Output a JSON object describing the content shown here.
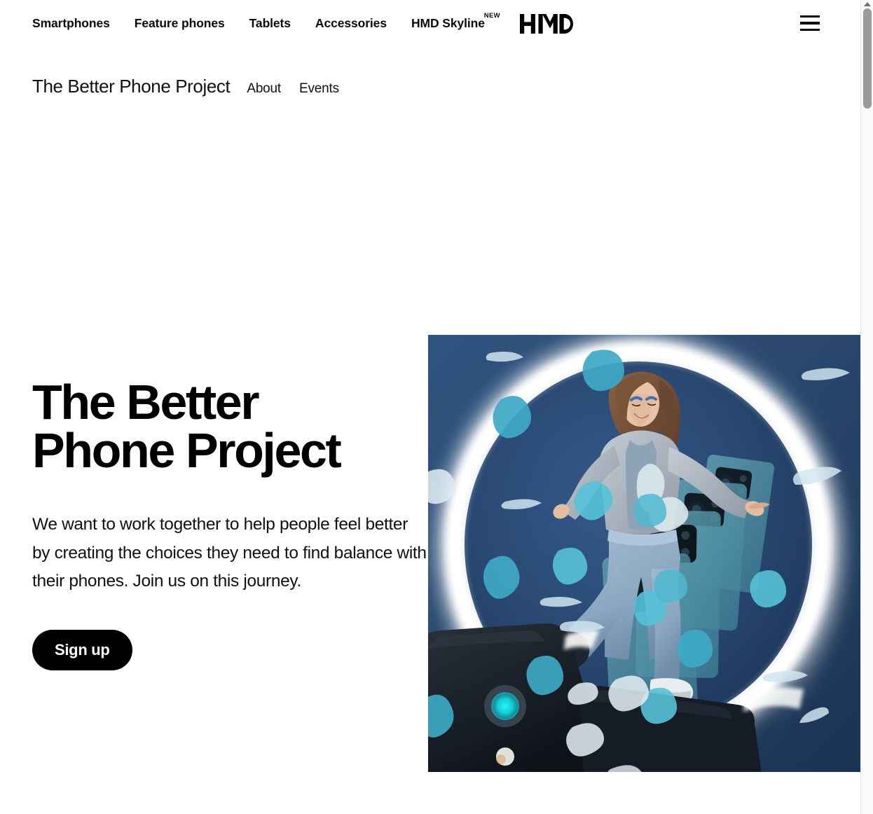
{
  "header": {
    "primary_nav": [
      {
        "label": "Smartphones",
        "badge": ""
      },
      {
        "label": "Feature phones",
        "badge": ""
      },
      {
        "label": "Tablets",
        "badge": ""
      },
      {
        "label": "Accessories",
        "badge": ""
      },
      {
        "label": "HMD Skyline",
        "badge": "NEW"
      }
    ],
    "logo_text": "HMD",
    "menu_icon": "hamburger-icon"
  },
  "subnav": {
    "project_title": "The Better Phone Project",
    "links": [
      {
        "label": "About"
      },
      {
        "label": "Events"
      }
    ]
  },
  "hero": {
    "title": "The Better\nPhone Project",
    "subtitle": "We want to work together to help people feel better by creating the choices they need to find balance with their phones. Join us on this journey.",
    "cta_label": "Sign up",
    "image_alt": "Young woman standing on oversized dark phone camera modules inside a glowing white ring, surrounded by floating teal leaves and translucent phone cards on a deep blue background"
  },
  "colors": {
    "text_primary": "#0b0b0b",
    "button_bg": "#000000",
    "button_text": "#ffffff",
    "page_bg": "#ffffff",
    "hero_bg_deep_blue": "#2b4a70",
    "hero_bg_dark_blue": "#1d3557",
    "hero_ring_glow": "#ffffff",
    "hero_leaf_teal": "#45b4cf",
    "hero_leaf_pale": "#cfe3ec",
    "hero_phone_card": "#4e8a9c",
    "hero_lens_cyan": "#18dbe0",
    "hero_flash_white": "#e8e8e0",
    "hero_device_dark": "#151a22",
    "scrollbar_thumb": "#9a9a9a",
    "scrollbar_track": "#fafafa"
  },
  "scrollbar": {
    "thumb_position_percent": 1,
    "arrow_icon": "scroll-up-arrow-icon"
  }
}
